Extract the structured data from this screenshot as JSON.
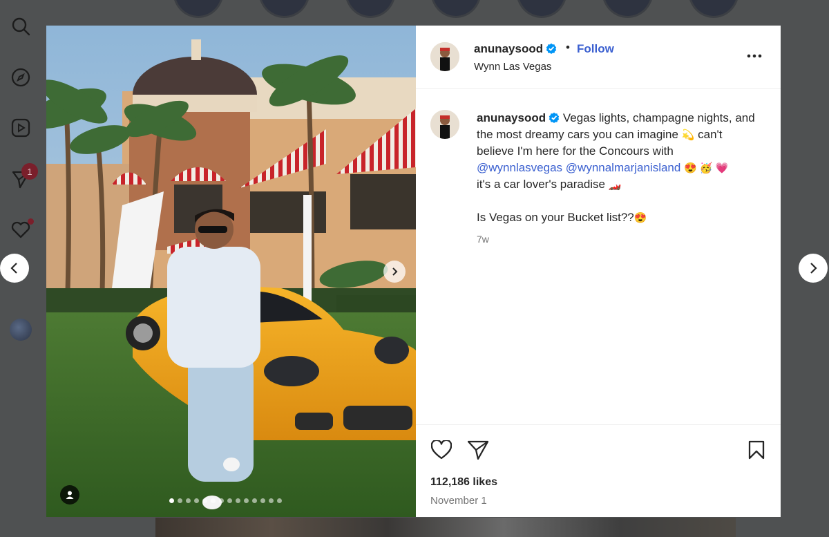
{
  "rail": {
    "icons": [
      "search-icon",
      "explore-icon",
      "reels-icon",
      "messages-icon",
      "notifications-icon",
      "create-icon",
      "profile-avatar"
    ],
    "messages_badge": "1"
  },
  "post": {
    "username": "anunaysood",
    "verified": true,
    "separator": "•",
    "follow_label": "Follow",
    "location": "Wynn Las Vegas",
    "caption": {
      "line1_text": "Vegas lights, champagne nights, and",
      "line2_text": "the most dreamy cars you can imagine",
      "line2_emoji": "💫",
      "line2_tail": "can't",
      "line3_text": "believe I'm here for the Concours with",
      "mention1": "@wynnlasvegas",
      "mention2": "@wynnalmarjanisland",
      "line4_emojis": "😍 🥳 💗",
      "line5_text": "it's a car lover's paradise",
      "line5_emoji": "🏎️",
      "line6_text": "Is Vegas on your Bucket list??",
      "line6_emoji": "😍",
      "time": "7w"
    },
    "likes": "112,186 likes",
    "date": "November 1",
    "carousel": {
      "count": 14,
      "active_index": 0
    }
  },
  "colors": {
    "accent_blue": "#3b60d0",
    "verified_blue": "#0095f6",
    "overlay": "#4f5152",
    "badge_red": "#7a1f2b"
  }
}
